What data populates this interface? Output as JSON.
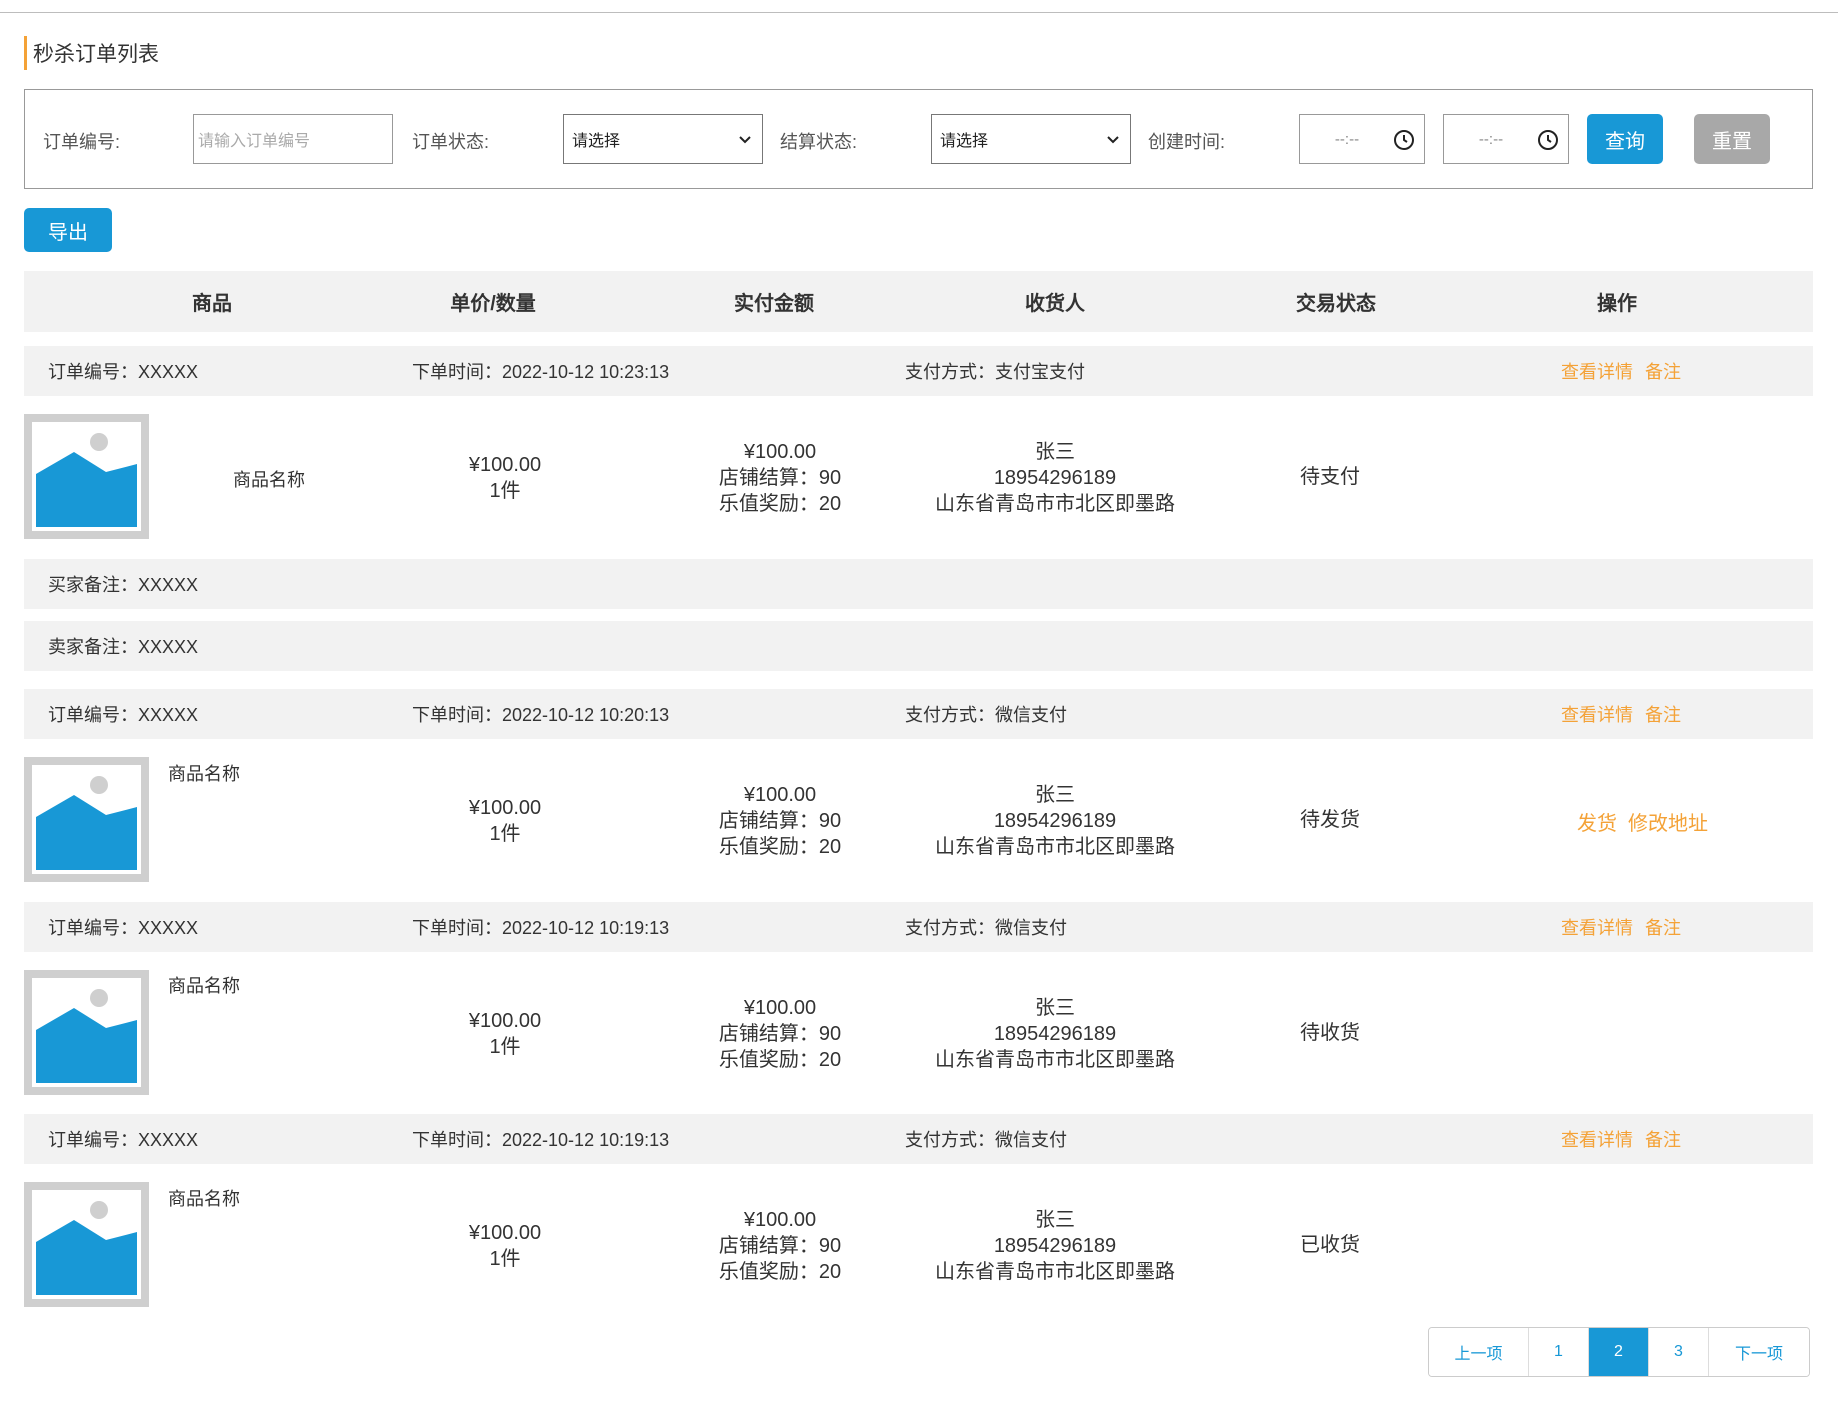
{
  "page": {
    "title": "秒杀订单列表"
  },
  "filters": {
    "order_no_label": "订单编号:",
    "order_no_placeholder": "请输入订单编号",
    "order_status_label": "订单状态:",
    "order_status_value": "请选择",
    "settle_status_label": "结算状态:",
    "settle_status_value": "请选择",
    "created_label": "创建时间:",
    "time_start": "--:--",
    "time_end": "--:--",
    "query_label": "查询",
    "reset_label": "重置"
  },
  "export_label": "导出",
  "columns": [
    "商品",
    "单价/数量",
    "实付金额",
    "收货人",
    "交易状态",
    "操作"
  ],
  "orders": [
    {
      "order_no": "订单编号：XXXXX",
      "time": "下单时间：2022-10-12 10:23:13",
      "payment": "支付方式：支付宝支付",
      "links": [
        "查看详情",
        "备注"
      ],
      "product_name": "商品名称",
      "price": "¥100.00",
      "qty": "1件",
      "paid": "¥100.00",
      "shop_settle": "店铺结算：90",
      "reward": "乐值奖励：20",
      "consignee": "张三",
      "phone": "18954296189",
      "address": "山东省青岛市市北区即墨路",
      "status": "待支付",
      "actions": [],
      "buyer_note": "买家备注：XXXXX",
      "seller_note": "卖家备注：XXXXX"
    },
    {
      "order_no": "订单编号：XXXXX",
      "time": "下单时间：2022-10-12 10:20:13",
      "payment": "支付方式：微信支付",
      "links": [
        "查看详情",
        "备注"
      ],
      "product_name": "商品名称",
      "price": "¥100.00",
      "qty": "1件",
      "paid": "¥100.00",
      "shop_settle": "店铺结算：90",
      "reward": "乐值奖励：20",
      "consignee": "张三",
      "phone": "18954296189",
      "address": "山东省青岛市市北区即墨路",
      "status": "待发货",
      "actions": [
        "发货",
        "修改地址"
      ]
    },
    {
      "order_no": "订单编号：XXXXX",
      "time": "下单时间：2022-10-12 10:19:13",
      "payment": "支付方式：微信支付",
      "links": [
        "查看详情",
        "备注"
      ],
      "product_name": "商品名称",
      "price": "¥100.00",
      "qty": "1件",
      "paid": "¥100.00",
      "shop_settle": "店铺结算：90",
      "reward": "乐值奖励：20",
      "consignee": "张三",
      "phone": "18954296189",
      "address": "山东省青岛市市北区即墨路",
      "status": "待收货",
      "actions": []
    },
    {
      "order_no": "订单编号：XXXXX",
      "time": "下单时间：2022-10-12 10:19:13",
      "payment": "支付方式：微信支付",
      "links": [
        "查看详情",
        "备注"
      ],
      "product_name": "商品名称",
      "price": "¥100.00",
      "qty": "1件",
      "paid": "¥100.00",
      "shop_settle": "店铺结算：90",
      "reward": "乐值奖励：20",
      "consignee": "张三",
      "phone": "18954296189",
      "address": "山东省青岛市市北区即墨路",
      "status": "已收货",
      "actions": []
    }
  ],
  "pagination": {
    "prev": "上一项",
    "pages": [
      "1",
      "2",
      "3"
    ],
    "current": "2",
    "next": "下一项"
  },
  "colors": {
    "primary": "#1898d6",
    "accent": "#f4a237",
    "header_bg": "#f2f2f2",
    "reset_gray": "#a8a8a8"
  },
  "icons": {
    "product_image": "image-placeholder-icon",
    "clock": "clock-icon",
    "dropdown": "chevron-down-icon"
  }
}
